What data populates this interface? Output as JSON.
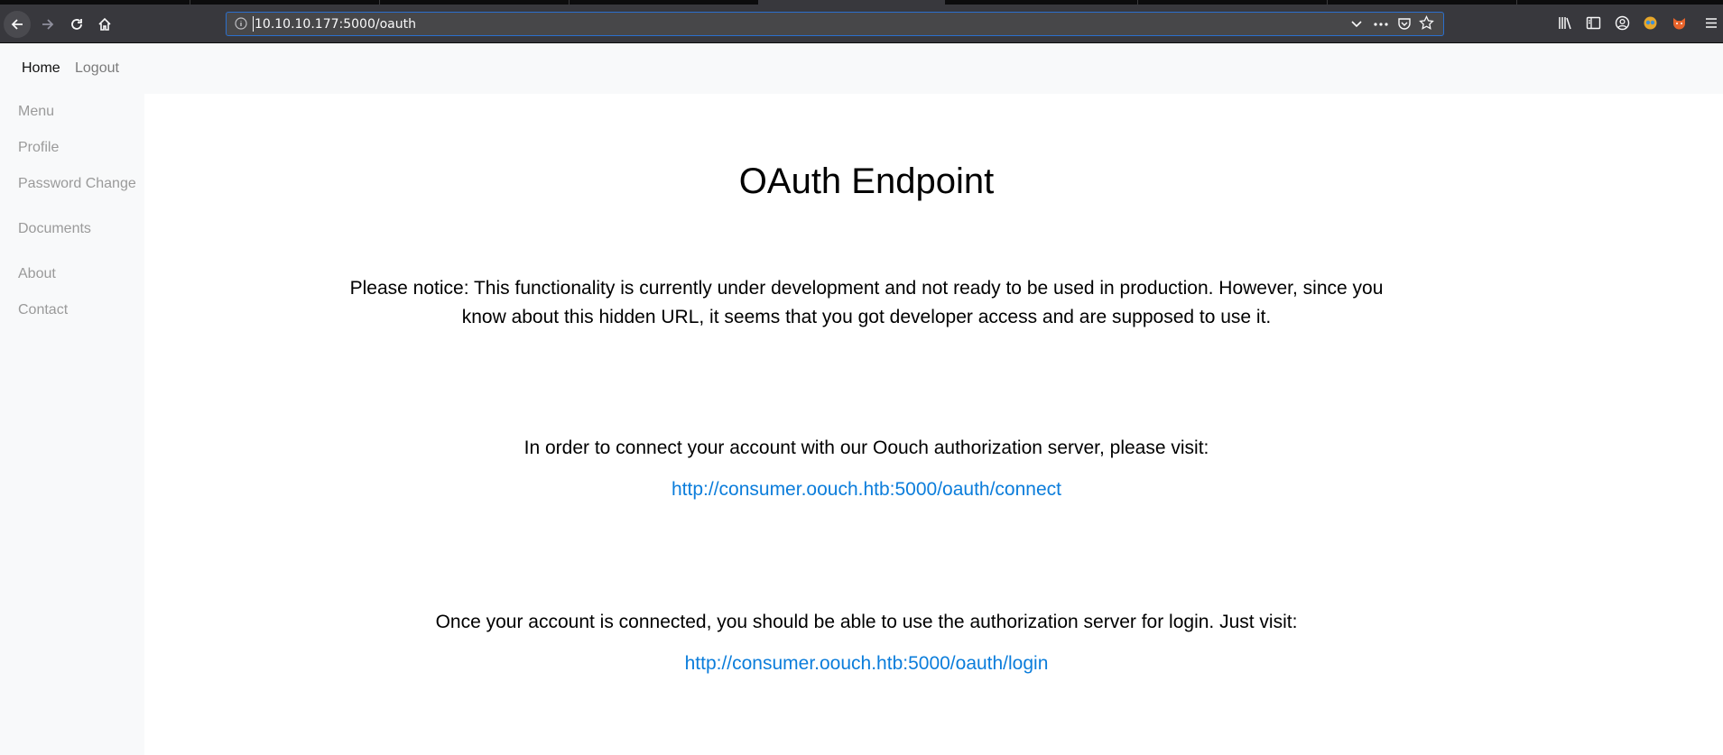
{
  "browser": {
    "url": "10.10.10.177:5000/oauth"
  },
  "navbar": {
    "home": "Home",
    "logout": "Logout"
  },
  "sidebar": {
    "items": [
      {
        "label": "Menu"
      },
      {
        "label": "Profile"
      },
      {
        "label": "Password Change"
      },
      {
        "label": "Documents"
      },
      {
        "label": "About"
      },
      {
        "label": "Contact"
      }
    ]
  },
  "main": {
    "title": "OAuth Endpoint",
    "notice": "Please notice: This functionality is currently under development and not ready to be used in production. However, since you know about this hidden URL, it seems that you got developer access and are supposed to use it.",
    "connect_text": "In order to connect your account with our Oouch authorization server, please visit:",
    "connect_link": "http://consumer.oouch.htb:5000/oauth/connect",
    "login_text": "Once your account is connected, you should be able to use the authorization server for login. Just visit:",
    "login_link": "http://consumer.oouch.htb:5000/oauth/login"
  },
  "colors": {
    "link": "#0b7ddb",
    "sidebar_text": "#9a9a9a",
    "chrome_bg": "#38383d"
  }
}
